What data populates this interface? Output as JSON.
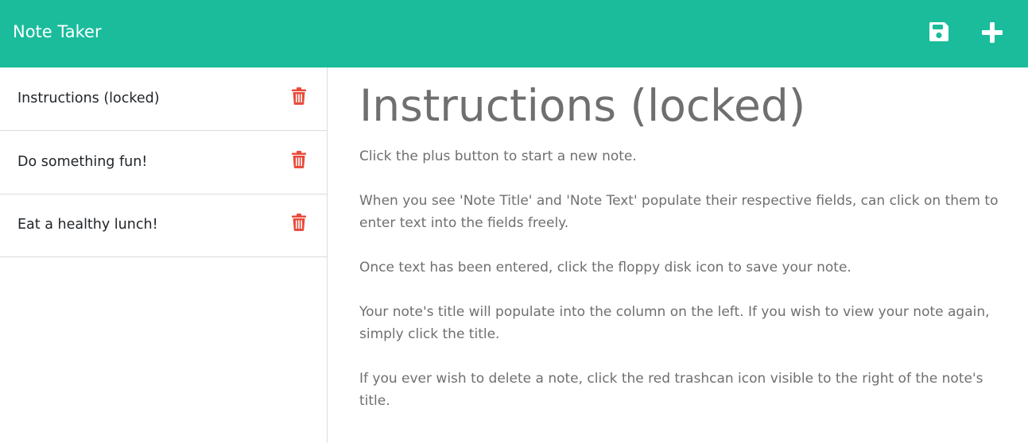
{
  "app": {
    "title": "Note Taker"
  },
  "toolbar": {
    "save_icon": "floppy-disk-icon",
    "new_icon": "plus-icon"
  },
  "sidebar": {
    "items": [
      {
        "label": "Instructions (locked)",
        "icon": "trash-icon"
      },
      {
        "label": "Do something fun!",
        "icon": "trash-icon"
      },
      {
        "label": "Eat a healthy lunch!",
        "icon": "trash-icon"
      }
    ]
  },
  "note": {
    "title": "Instructions (locked)",
    "paragraphs": [
      "Click the plus button to start a new note.",
      "When you see 'Note Title' and 'Note Text' populate their respective fields, can click on them to enter text into the fields freely.",
      "Once text has been entered, click the floppy disk icon to save your note.",
      "Your note's title will populate into the column on the left. If you wish to view your note again, simply click the title.",
      "If you ever wish to delete a note, click the red trashcan icon visible to the right of the note's title."
    ]
  },
  "colors": {
    "navbar": "#1abc9c",
    "trash": "#e74c3c",
    "text_muted": "#6f6f6f"
  }
}
